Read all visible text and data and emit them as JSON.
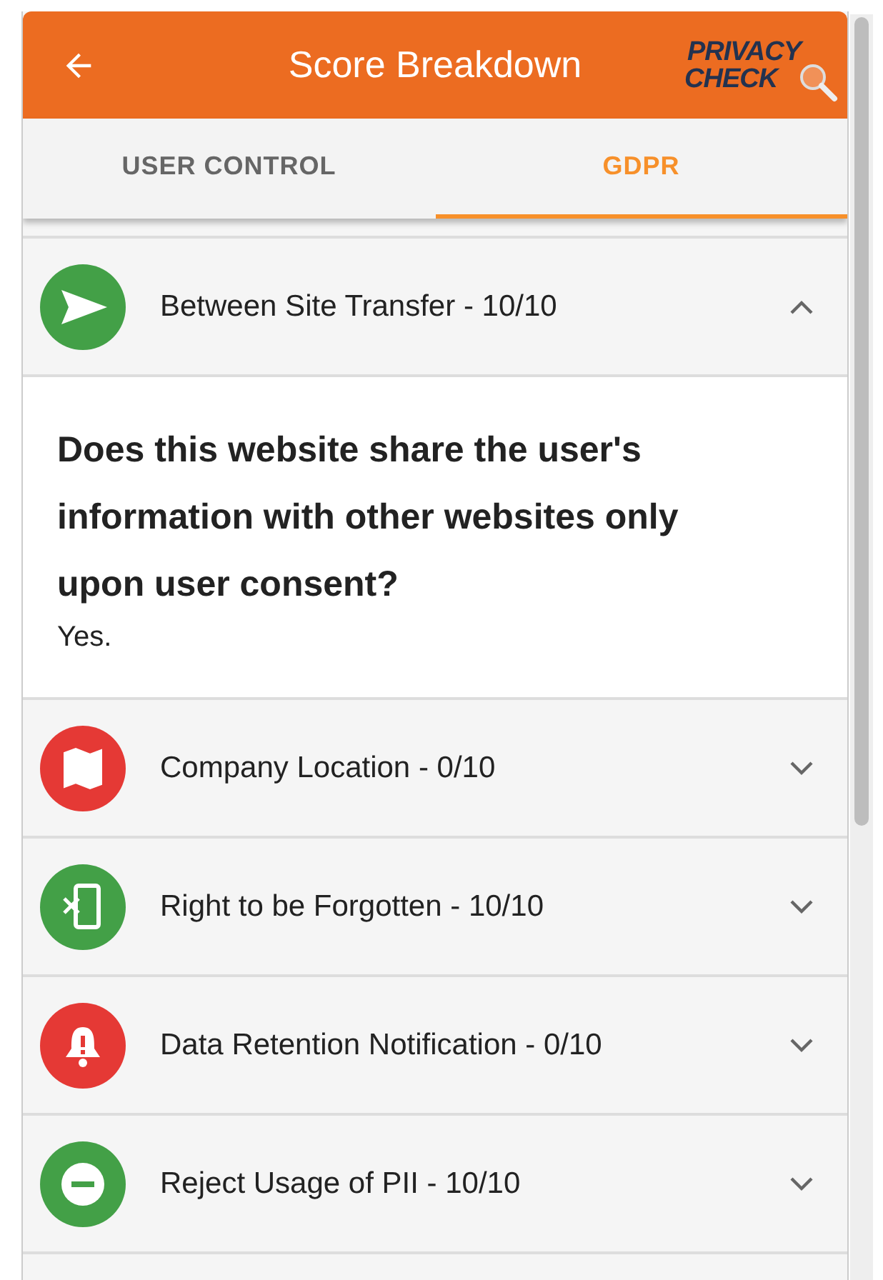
{
  "header": {
    "title": "Score Breakdown",
    "logo": [
      "PRIVACY",
      "CHECK"
    ]
  },
  "tabs": [
    {
      "label": "USER CONTROL",
      "selected": false
    },
    {
      "label": "GDPR",
      "selected": true
    }
  ],
  "items": [
    {
      "kind": "send",
      "color": "#43a047",
      "title": "Between Site Transfer - 10/10",
      "expanded": true,
      "question": "Does this website share the user's information with other websites only upon user consent?",
      "answer": "Yes."
    },
    {
      "kind": "map",
      "color": "#e53935",
      "title": "Company Location - 0/10",
      "expanded": false
    },
    {
      "kind": "phone-x",
      "color": "#43a047",
      "title": "Right to be Forgotten - 10/10",
      "expanded": false
    },
    {
      "kind": "bell",
      "color": "#e53935",
      "title": "Data Retention Notification - 0/10",
      "expanded": false
    },
    {
      "kind": "minus",
      "color": "#43a047",
      "title": "Reject Usage of PII - 10/10",
      "expanded": false
    }
  ]
}
